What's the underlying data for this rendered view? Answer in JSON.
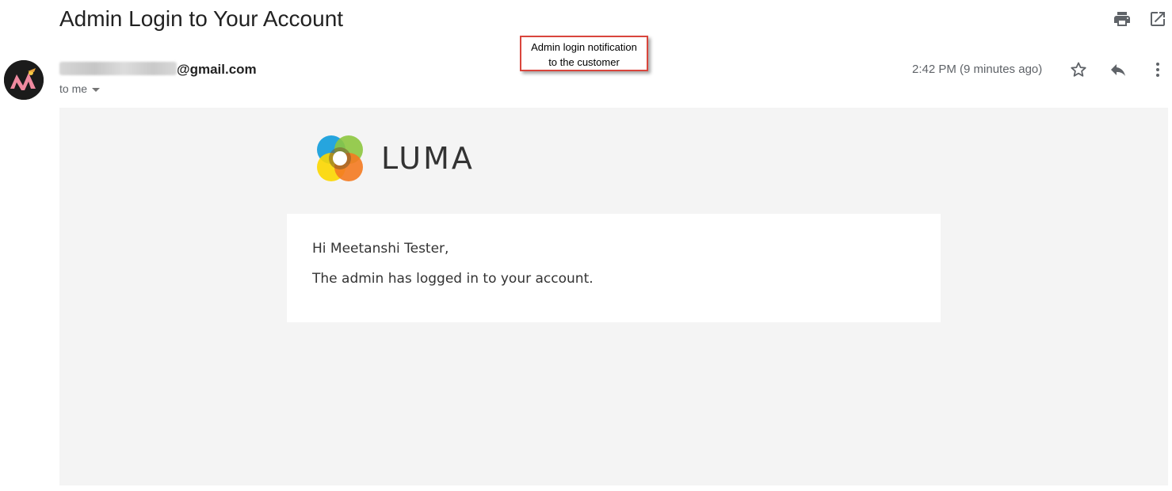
{
  "email": {
    "subject": "Admin Login to Your Account",
    "sender_visible_suffix": "@gmail.com",
    "recipient_label": "to me",
    "timestamp": "2:42 PM (9 minutes ago)"
  },
  "annotation": {
    "line1": "Admin login notification",
    "line2": "to the customer",
    "border_color": "#d9453c"
  },
  "toolbar": {
    "icons": [
      "print-icon",
      "open-in-new-window-icon"
    ]
  },
  "message_actions": {
    "icons": [
      "star-icon",
      "reply-icon",
      "more-options-icon"
    ]
  },
  "body": {
    "brand_name": "LUMA",
    "greeting": "Hi Meetanshi Tester,",
    "message": "The admin has logged in to your account."
  },
  "colors": {
    "body_background": "#f4f4f4",
    "card_background": "#ffffff",
    "logo_blue": "#1aa0dc",
    "logo_green": "#8dc63f",
    "logo_yellow": "#fcd700",
    "logo_orange": "#f47a20"
  }
}
